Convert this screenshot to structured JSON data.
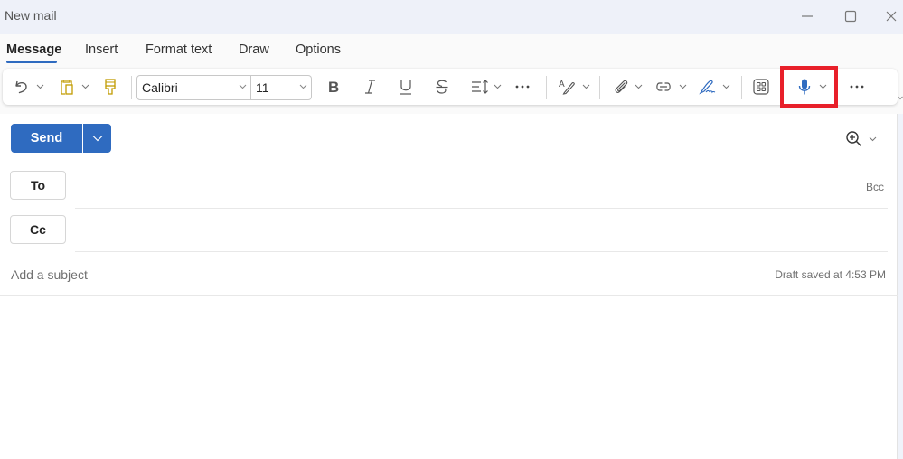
{
  "window": {
    "title": "New mail",
    "controls": {
      "minimize": "minimize-icon",
      "maximize": "maximize-icon",
      "close": "close-icon"
    }
  },
  "ribbon": {
    "tabs": [
      {
        "label": "Message",
        "active": true
      },
      {
        "label": "Insert",
        "active": false
      },
      {
        "label": "Format text",
        "active": false
      },
      {
        "label": "Draw",
        "active": false
      },
      {
        "label": "Options",
        "active": false
      }
    ],
    "toolbar": {
      "font_name": "Calibri",
      "font_size": "11",
      "icons": [
        "undo-icon",
        "clipboard-paste-icon",
        "format-painter-icon",
        "bold-icon",
        "italic-icon",
        "underline-icon",
        "strikethrough-icon",
        "paragraph-spacing-icon",
        "more-formatting-icon",
        "editor-icon",
        "attach-icon",
        "link-icon",
        "signature-icon",
        "apps-icon",
        "dictate-microphone-icon",
        "more-options-icon"
      ],
      "highlighted_control": "dictate-microphone-icon"
    }
  },
  "colors": {
    "accent": "#2f6bc0",
    "highlight_border": "#e8202a",
    "microphone": "#2f6bc0",
    "signature": "#2f6bc0",
    "clipboard": "#c19c00"
  },
  "compose": {
    "send_label": "Send",
    "to_label": "To",
    "cc_label": "Cc",
    "bcc_label": "Bcc",
    "to_value": "",
    "cc_value": "",
    "subject_placeholder": "Add a subject",
    "subject_value": "",
    "draft_status": "Draft saved at 4:53 PM"
  }
}
